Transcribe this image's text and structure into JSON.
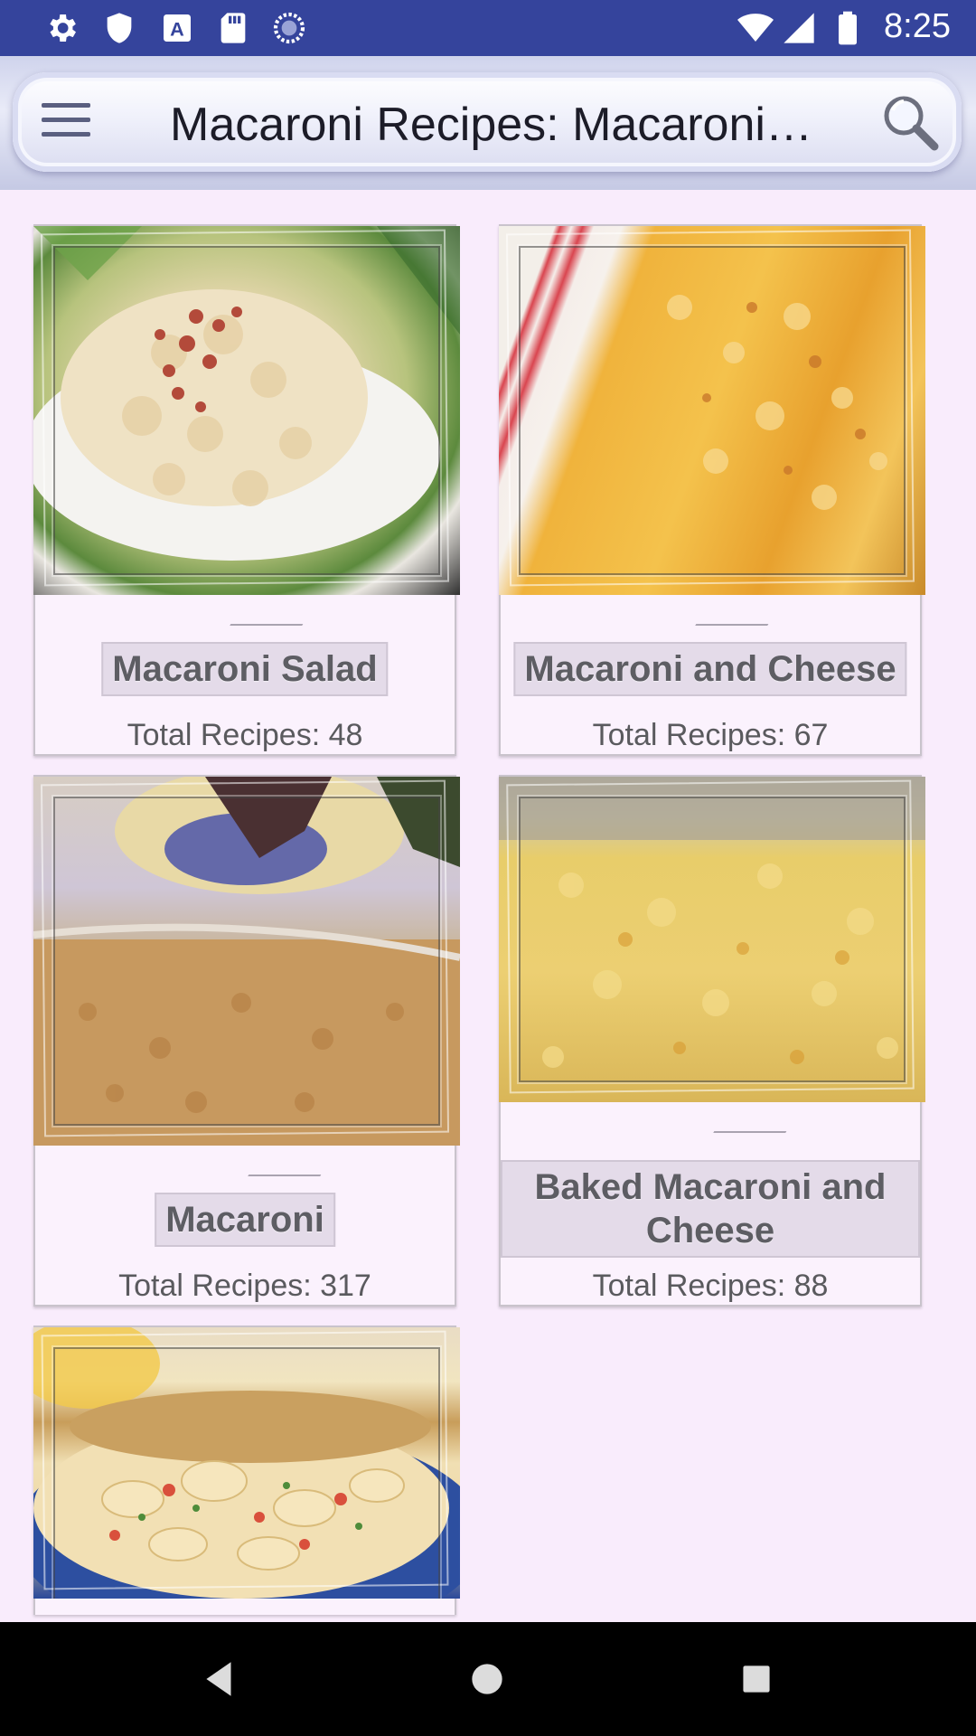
{
  "status_bar": {
    "time": "8:25",
    "left_icons": [
      "gear-icon",
      "shield-icon",
      "font-a-icon",
      "sd-card-icon",
      "sync-circle-icon"
    ],
    "right_icons": [
      "wifi-icon",
      "signal-icon",
      "battery-icon"
    ]
  },
  "app_bar": {
    "title": "Macaroni Recipes: Macaroni…",
    "menu_icon": "hamburger-menu-icon",
    "search_icon": "search-icon"
  },
  "categories": [
    {
      "label": "Macaroni Salad",
      "count": "Total Recipes: 48"
    },
    {
      "label": "Macaroni and Cheese",
      "count": "Total Recipes: 67"
    },
    {
      "label": "Macaroni",
      "count": "Total Recipes: 317"
    },
    {
      "label": "Baked Macaroni and Cheese",
      "count": "Total Recipes: 88"
    },
    {
      "label": "",
      "count": ""
    }
  ],
  "nav_bar": {
    "icons": [
      "back-icon",
      "home-icon",
      "recents-icon"
    ]
  },
  "colors": {
    "status_bar": "#35449c",
    "background": "#f9ecfc",
    "label_bg": "#e4dbe9"
  }
}
